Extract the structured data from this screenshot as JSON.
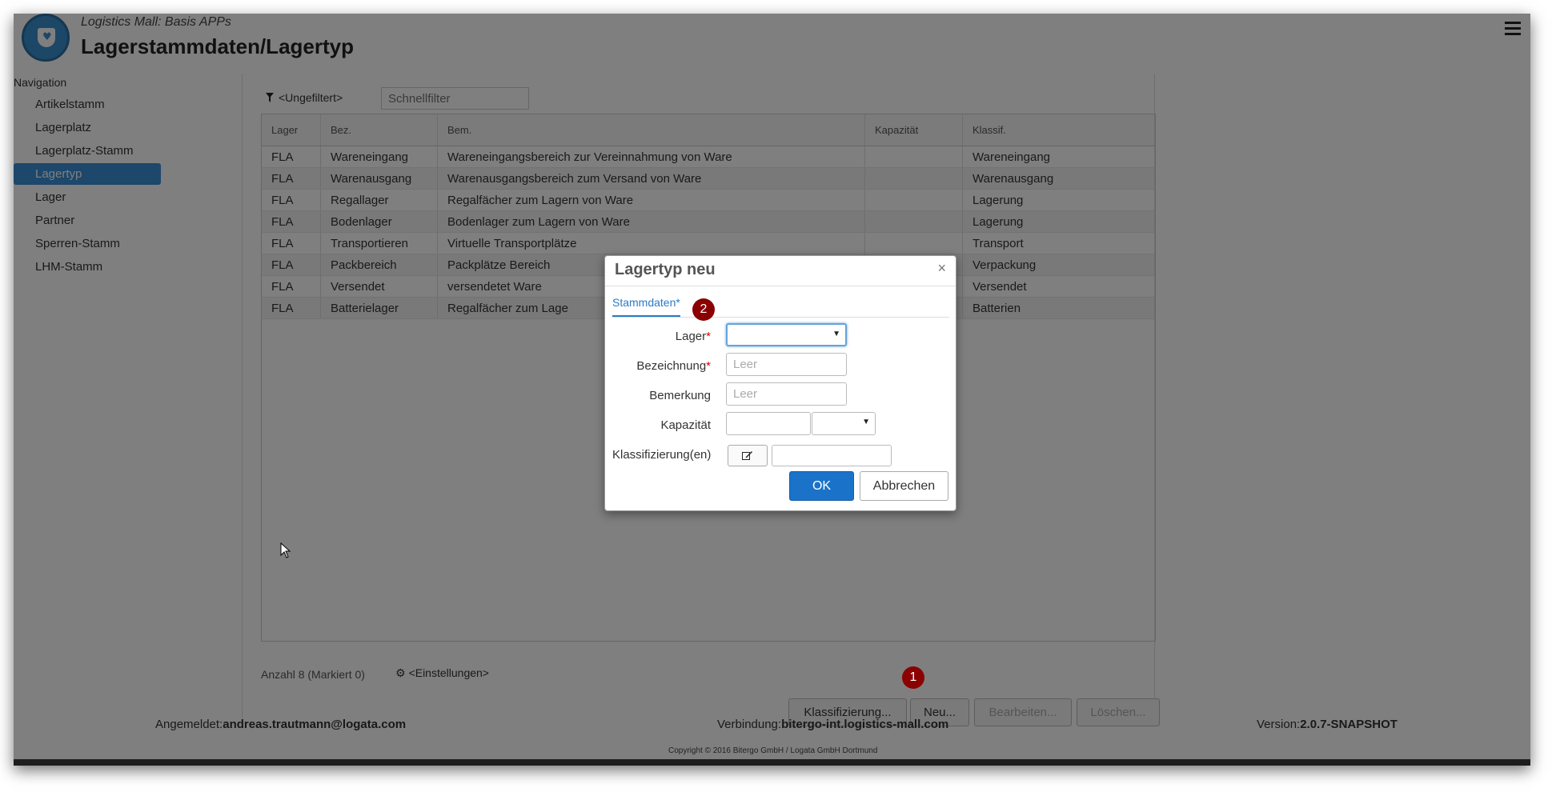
{
  "header": {
    "app_subtitle": "Logistics Mall: Basis APPs",
    "title": "Lagerstammdaten/Lagertyp"
  },
  "nav": {
    "heading": "Navigation",
    "items": [
      {
        "label": "Artikelstamm"
      },
      {
        "label": "Lagerplatz"
      },
      {
        "label": "Lagerplatz-Stamm"
      },
      {
        "label": "Lagertyp"
      },
      {
        "label": "Lager"
      },
      {
        "label": "Partner"
      },
      {
        "label": "Sperren-Stamm"
      },
      {
        "label": "LHM-Stamm"
      }
    ],
    "active": "Lagertyp"
  },
  "filter": {
    "label": "<Ungefiltert>",
    "placeholder": "Schnellfilter"
  },
  "table": {
    "columns": [
      "Lager",
      "Bez.",
      "Bem.",
      "Kapazität",
      "Klassif."
    ],
    "rows": [
      [
        "FLA",
        "Wareneingang",
        "Wareneingangsbereich zur Vereinnahmung von Ware",
        "",
        "Wareneingang"
      ],
      [
        "FLA",
        "Warenausgang",
        "Warenausgangsbereich zum Versand von Ware",
        "",
        "Warenausgang"
      ],
      [
        "FLA",
        "Regallager",
        "Regalfächer zum Lagern von Ware",
        "",
        "Lagerung"
      ],
      [
        "FLA",
        "Bodenlager",
        "Bodenlager zum Lagern von Ware",
        "",
        "Lagerung"
      ],
      [
        "FLA",
        "Transportieren",
        "Virtuelle Transportplätze",
        "",
        "Transport"
      ],
      [
        "FLA",
        "Packbereich",
        "Packplätze Bereich",
        "",
        "Verpackung"
      ],
      [
        "FLA",
        "Versendet",
        "versendetet Ware",
        "",
        "Versendet"
      ],
      [
        "FLA",
        "Batterielager",
        "Regalfächer zum Lage",
        "",
        "Batterien"
      ]
    ]
  },
  "status": {
    "count": "Anzahl 8 (Markiert 0)",
    "settings": "<Einstellungen>"
  },
  "buttons": {
    "klassifizierung": "Klassifizierung...",
    "neu": "Neu...",
    "bearbeiten": "Bearbeiten...",
    "loeschen": "Löschen..."
  },
  "footer": {
    "user_label": "Angemeldet:",
    "user": "andreas.trautmann@logata.com",
    "connection_label": "Verbindung:",
    "connection": "bitergo-int.logistics-mall.com",
    "version_label": "Version:",
    "version": "2.0.7-SNAPSHOT",
    "copyright": "Copyright © 2016 Bitergo GmbH / Logata GmbH Dortmund"
  },
  "dialog": {
    "title": "Lagertyp neu",
    "close": "×",
    "tab": "Stammdaten*",
    "fields": {
      "lager_label": "Lager",
      "bezeichnung_label": "Bezeichnung",
      "bezeichnung_placeholder": "Leer",
      "bemerkung_label": "Bemerkung",
      "bemerkung_placeholder": "Leer",
      "kapazitaet_label": "Kapazität",
      "klassifizierung_label": "Klassifizierung(en)"
    },
    "ok": "OK",
    "cancel": "Abbrechen"
  },
  "annotations": {
    "badge1": "1",
    "badge2": "2"
  },
  "colors": {
    "accent": "#1a73c9",
    "nav_active": "#3a8fd6",
    "badge": "#8b0000"
  }
}
